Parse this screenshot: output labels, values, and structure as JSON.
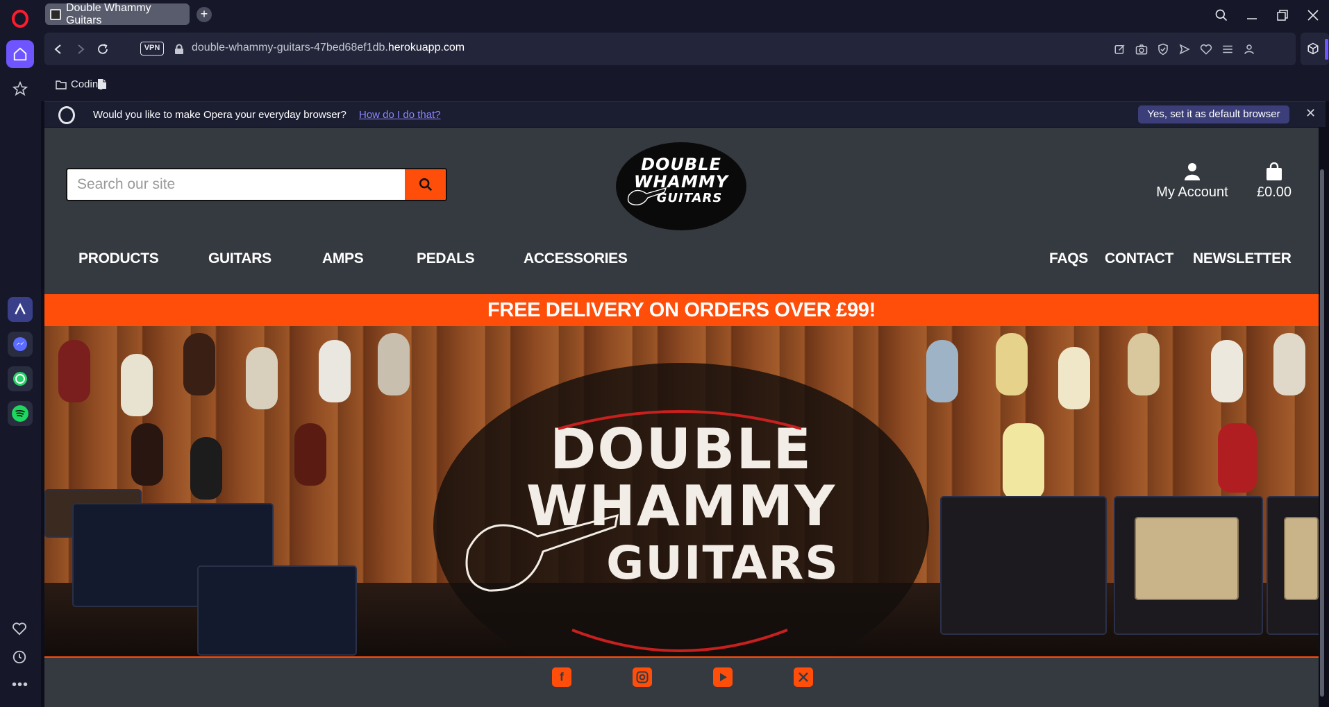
{
  "browser": {
    "tab_title": "Double Whammy Guitars",
    "new_tab_symbol": "+",
    "vpn_label": "VPN",
    "url_prefix": "double-whammy-guitars-47bed68ef1db.",
    "url_domain": "herokuapp.com",
    "bookmarks": [
      {
        "label": "Coding"
      }
    ],
    "notice": {
      "text": "Would you like to make Opera your everyday browser?",
      "link": "How do I do that?",
      "button": "Yes, set it as default browser",
      "close_symbol": "✕"
    },
    "sidebar_apps": [
      "aria-icon",
      "messenger-icon",
      "whatsapp-icon",
      "spotify-icon"
    ]
  },
  "site": {
    "search": {
      "placeholder": "Search our site"
    },
    "logo": {
      "line1": "DOUBLE",
      "line2": "WHAMMY",
      "line3": "GUITARS"
    },
    "account_label": "My Account",
    "cart_total": "£0.00",
    "nav_left": [
      "PRODUCTS",
      "GUITARS",
      "AMPS",
      "PEDALS",
      "ACCESSORIES"
    ],
    "nav_right": [
      "FAQS",
      "CONTACT",
      "NEWSLETTER"
    ],
    "promo": "FREE DELIVERY ON ORDERS OVER £99!",
    "hero": {
      "line1": "DOUBLE",
      "line2": "WHAMMY",
      "line3": "GUITARS"
    },
    "social": [
      "facebook-icon",
      "instagram-icon",
      "youtube-icon",
      "x-icon"
    ]
  },
  "colors": {
    "accent": "#ff4d0a",
    "header_bg": "#353a40",
    "opera_accent": "#6f55ff"
  }
}
